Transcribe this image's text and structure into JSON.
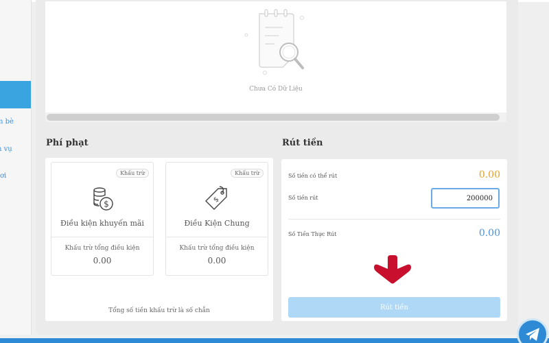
{
  "sidebar": {
    "items": [
      {
        "label": "n bè"
      },
      {
        "label": "n vụ"
      },
      {
        "label": "ơi"
      }
    ]
  },
  "history": {
    "empty_text": "Chưa Có Dữ Liệu"
  },
  "penalty": {
    "title": "Phí phạt",
    "cards": [
      {
        "tag": "Khấu trừ",
        "name": "Điều kiện khuyến mãi",
        "deduct_label": "Khấu trừ tổng điều kiện",
        "deduct_value": "0.00",
        "icon": "coins-dollar-icon"
      },
      {
        "tag": "Khấu trừ",
        "name": "Điều Kiện Chung",
        "deduct_label": "Khấu trừ tổng điều kiện",
        "deduct_value": "0.00",
        "icon": "price-tag-icon"
      }
    ],
    "note": "Tổng số tiền khấu trừ là số chẵn"
  },
  "withdraw": {
    "title": "Rút tiền",
    "available_label": "Số tiền có thể rút",
    "available_value": "0.00",
    "amount_label": "Số tiền rút",
    "amount_value": "200000",
    "actual_label": "Số Tiền Thực Rút",
    "actual_value": "0.00",
    "button_label": "Rút tiền"
  },
  "colors": {
    "accent": "#39a4e0",
    "available": "#e5a024",
    "actual": "#4a90d9",
    "arrow": "#c8102e"
  }
}
